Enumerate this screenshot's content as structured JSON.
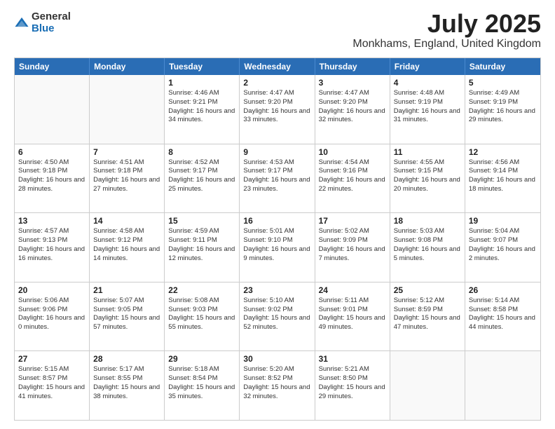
{
  "logo": {
    "general": "General",
    "blue": "Blue"
  },
  "title": {
    "month": "July 2025",
    "location": "Monkhams, England, United Kingdom"
  },
  "header": {
    "days": [
      "Sunday",
      "Monday",
      "Tuesday",
      "Wednesday",
      "Thursday",
      "Friday",
      "Saturday"
    ]
  },
  "weeks": [
    [
      {
        "day": "",
        "empty": true
      },
      {
        "day": "",
        "empty": true
      },
      {
        "day": "1",
        "sunrise": "Sunrise: 4:46 AM",
        "sunset": "Sunset: 9:21 PM",
        "daylight": "Daylight: 16 hours and 34 minutes."
      },
      {
        "day": "2",
        "sunrise": "Sunrise: 4:47 AM",
        "sunset": "Sunset: 9:20 PM",
        "daylight": "Daylight: 16 hours and 33 minutes."
      },
      {
        "day": "3",
        "sunrise": "Sunrise: 4:47 AM",
        "sunset": "Sunset: 9:20 PM",
        "daylight": "Daylight: 16 hours and 32 minutes."
      },
      {
        "day": "4",
        "sunrise": "Sunrise: 4:48 AM",
        "sunset": "Sunset: 9:19 PM",
        "daylight": "Daylight: 16 hours and 31 minutes."
      },
      {
        "day": "5",
        "sunrise": "Sunrise: 4:49 AM",
        "sunset": "Sunset: 9:19 PM",
        "daylight": "Daylight: 16 hours and 29 minutes."
      }
    ],
    [
      {
        "day": "6",
        "sunrise": "Sunrise: 4:50 AM",
        "sunset": "Sunset: 9:18 PM",
        "daylight": "Daylight: 16 hours and 28 minutes."
      },
      {
        "day": "7",
        "sunrise": "Sunrise: 4:51 AM",
        "sunset": "Sunset: 9:18 PM",
        "daylight": "Daylight: 16 hours and 27 minutes."
      },
      {
        "day": "8",
        "sunrise": "Sunrise: 4:52 AM",
        "sunset": "Sunset: 9:17 PM",
        "daylight": "Daylight: 16 hours and 25 minutes."
      },
      {
        "day": "9",
        "sunrise": "Sunrise: 4:53 AM",
        "sunset": "Sunset: 9:17 PM",
        "daylight": "Daylight: 16 hours and 23 minutes."
      },
      {
        "day": "10",
        "sunrise": "Sunrise: 4:54 AM",
        "sunset": "Sunset: 9:16 PM",
        "daylight": "Daylight: 16 hours and 22 minutes."
      },
      {
        "day": "11",
        "sunrise": "Sunrise: 4:55 AM",
        "sunset": "Sunset: 9:15 PM",
        "daylight": "Daylight: 16 hours and 20 minutes."
      },
      {
        "day": "12",
        "sunrise": "Sunrise: 4:56 AM",
        "sunset": "Sunset: 9:14 PM",
        "daylight": "Daylight: 16 hours and 18 minutes."
      }
    ],
    [
      {
        "day": "13",
        "sunrise": "Sunrise: 4:57 AM",
        "sunset": "Sunset: 9:13 PM",
        "daylight": "Daylight: 16 hours and 16 minutes."
      },
      {
        "day": "14",
        "sunrise": "Sunrise: 4:58 AM",
        "sunset": "Sunset: 9:12 PM",
        "daylight": "Daylight: 16 hours and 14 minutes."
      },
      {
        "day": "15",
        "sunrise": "Sunrise: 4:59 AM",
        "sunset": "Sunset: 9:11 PM",
        "daylight": "Daylight: 16 hours and 12 minutes."
      },
      {
        "day": "16",
        "sunrise": "Sunrise: 5:01 AM",
        "sunset": "Sunset: 9:10 PM",
        "daylight": "Daylight: 16 hours and 9 minutes."
      },
      {
        "day": "17",
        "sunrise": "Sunrise: 5:02 AM",
        "sunset": "Sunset: 9:09 PM",
        "daylight": "Daylight: 16 hours and 7 minutes."
      },
      {
        "day": "18",
        "sunrise": "Sunrise: 5:03 AM",
        "sunset": "Sunset: 9:08 PM",
        "daylight": "Daylight: 16 hours and 5 minutes."
      },
      {
        "day": "19",
        "sunrise": "Sunrise: 5:04 AM",
        "sunset": "Sunset: 9:07 PM",
        "daylight": "Daylight: 16 hours and 2 minutes."
      }
    ],
    [
      {
        "day": "20",
        "sunrise": "Sunrise: 5:06 AM",
        "sunset": "Sunset: 9:06 PM",
        "daylight": "Daylight: 16 hours and 0 minutes."
      },
      {
        "day": "21",
        "sunrise": "Sunrise: 5:07 AM",
        "sunset": "Sunset: 9:05 PM",
        "daylight": "Daylight: 15 hours and 57 minutes."
      },
      {
        "day": "22",
        "sunrise": "Sunrise: 5:08 AM",
        "sunset": "Sunset: 9:03 PM",
        "daylight": "Daylight: 15 hours and 55 minutes."
      },
      {
        "day": "23",
        "sunrise": "Sunrise: 5:10 AM",
        "sunset": "Sunset: 9:02 PM",
        "daylight": "Daylight: 15 hours and 52 minutes."
      },
      {
        "day": "24",
        "sunrise": "Sunrise: 5:11 AM",
        "sunset": "Sunset: 9:01 PM",
        "daylight": "Daylight: 15 hours and 49 minutes."
      },
      {
        "day": "25",
        "sunrise": "Sunrise: 5:12 AM",
        "sunset": "Sunset: 8:59 PM",
        "daylight": "Daylight: 15 hours and 47 minutes."
      },
      {
        "day": "26",
        "sunrise": "Sunrise: 5:14 AM",
        "sunset": "Sunset: 8:58 PM",
        "daylight": "Daylight: 15 hours and 44 minutes."
      }
    ],
    [
      {
        "day": "27",
        "sunrise": "Sunrise: 5:15 AM",
        "sunset": "Sunset: 8:57 PM",
        "daylight": "Daylight: 15 hours and 41 minutes."
      },
      {
        "day": "28",
        "sunrise": "Sunrise: 5:17 AM",
        "sunset": "Sunset: 8:55 PM",
        "daylight": "Daylight: 15 hours and 38 minutes."
      },
      {
        "day": "29",
        "sunrise": "Sunrise: 5:18 AM",
        "sunset": "Sunset: 8:54 PM",
        "daylight": "Daylight: 15 hours and 35 minutes."
      },
      {
        "day": "30",
        "sunrise": "Sunrise: 5:20 AM",
        "sunset": "Sunset: 8:52 PM",
        "daylight": "Daylight: 15 hours and 32 minutes."
      },
      {
        "day": "31",
        "sunrise": "Sunrise: 5:21 AM",
        "sunset": "Sunset: 8:50 PM",
        "daylight": "Daylight: 15 hours and 29 minutes."
      },
      {
        "day": "",
        "empty": true
      },
      {
        "day": "",
        "empty": true
      }
    ]
  ]
}
